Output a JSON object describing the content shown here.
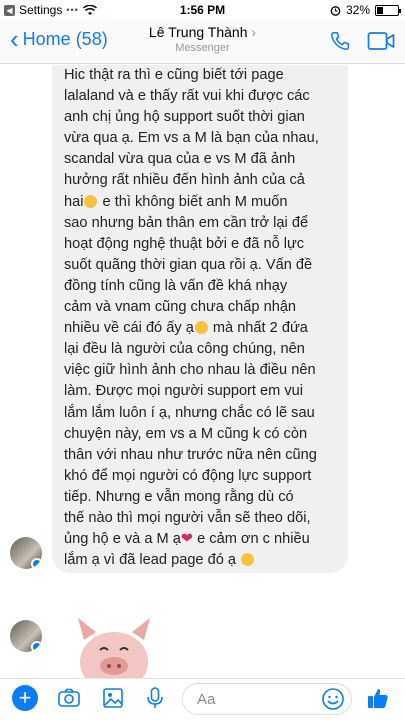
{
  "status_bar": {
    "carrier": "Settings",
    "time": "1:56 PM",
    "battery_percent": "32%",
    "battery_level": 0.32
  },
  "nav": {
    "back_label": "Home (58)",
    "title": "Lê Trung Thành",
    "subtitle": "Messenger"
  },
  "message": {
    "lines": [
      "Hic thật ra thì e cũng biết tới page",
      "lalaland và e thấy rất vui khi được các",
      "anh chị ủng hộ support suốt thời gian",
      "vừa qua ạ. Em vs a M là bạn của nhau,",
      "scandal vừa qua của e vs M đã ảnh",
      "hưởng rất nhiều đến hình ảnh của cả",
      "hai",
      " e thì không biết anh M muốn",
      "sao nhưng bản thân em cần trở lại để",
      "hoạt động nghệ thuật bởi e đã nỗ lực",
      "suốt quãng thời gian qua rồi ạ. Vấn đề",
      "đồng tính cũng là vấn đề khá nhạy",
      "cảm và vnam cũng chưa chấp nhận",
      "nhiều về cái đó ấy ạ",
      " mà nhất 2 đứa",
      "lại đều là người của công chúng, nên",
      "việc giữ hình ảnh cho nhau là điều nên",
      "làm. Được mọi người support em vui",
      "lắm lắm luôn í ạ, nhưng chắc có lẽ sau",
      "chuyện này, em vs a M cũng k có còn",
      "thân với nhau như trước nữa nên cũng",
      "khó để mọi người có động lực support",
      "tiếp. Nhưng e vẫn mong rằng dù có",
      "thế nào thì mọi người vẫn sẽ theo dõi,",
      "ủng hộ e và a M ạ",
      " e cảm ơn c nhiều",
      "lắm ạ vì đã lead page đó ạ"
    ]
  },
  "composer": {
    "placeholder": "Aa"
  },
  "colors": {
    "accent": "#0a7cff",
    "bubble": "#f1f0f0"
  }
}
